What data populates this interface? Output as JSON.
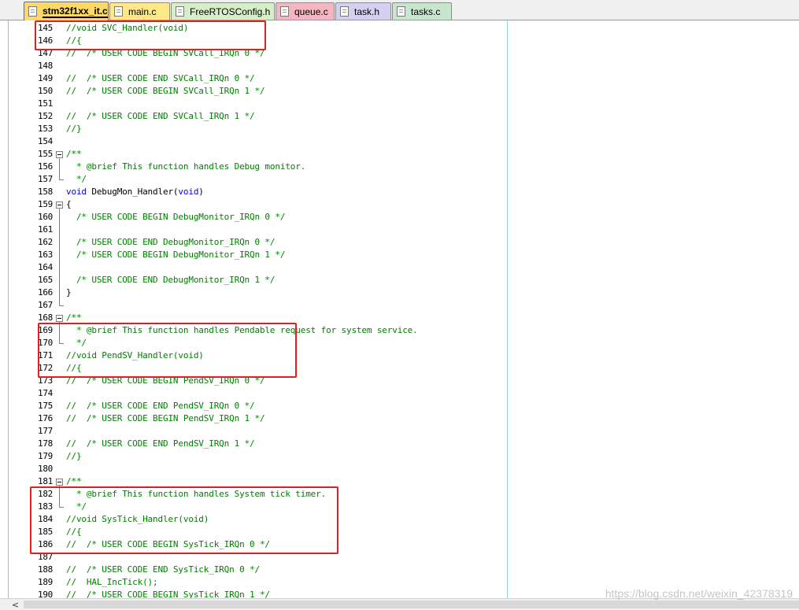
{
  "tabs": [
    {
      "label": "stm32f1xx_it.c",
      "active": true,
      "color": "#ffd966"
    },
    {
      "label": "main.c",
      "active": false,
      "color": "#ffe88a"
    },
    {
      "label": "FreeRTOSConfig.h",
      "active": false,
      "color": "#d7efc9"
    },
    {
      "label": "queue.c",
      "active": false,
      "color": "#f4b6c2"
    },
    {
      "label": "task.h",
      "active": false,
      "color": "#d5d0f2"
    },
    {
      "label": "tasks.c",
      "active": false,
      "color": "#c8e6cd"
    }
  ],
  "lines": [
    {
      "num": "145",
      "fold": "none",
      "parts": [
        {
          "t": "c",
          "s": "//void SVC_Handler(void)"
        }
      ]
    },
    {
      "num": "146",
      "fold": "none",
      "parts": [
        {
          "t": "c",
          "s": "//{"
        }
      ]
    },
    {
      "num": "147",
      "fold": "none",
      "parts": [
        {
          "t": "c",
          "s": "//  /* USER CODE BEGIN SVCall_IRQn 0 */"
        }
      ]
    },
    {
      "num": "148",
      "fold": "none",
      "parts": []
    },
    {
      "num": "149",
      "fold": "none",
      "parts": [
        {
          "t": "c",
          "s": "//  /* USER CODE END SVCall_IRQn 0 */"
        }
      ]
    },
    {
      "num": "150",
      "fold": "none",
      "parts": [
        {
          "t": "c",
          "s": "//  /* USER CODE BEGIN SVCall_IRQn 1 */"
        }
      ]
    },
    {
      "num": "151",
      "fold": "none",
      "parts": []
    },
    {
      "num": "152",
      "fold": "none",
      "parts": [
        {
          "t": "c",
          "s": "//  /* USER CODE END SVCall_IRQn 1 */"
        }
      ]
    },
    {
      "num": "153",
      "fold": "none",
      "parts": [
        {
          "t": "c",
          "s": "//}"
        }
      ]
    },
    {
      "num": "154",
      "fold": "none",
      "parts": []
    },
    {
      "num": "155",
      "fold": "start",
      "parts": [
        {
          "t": "c",
          "s": "/**"
        }
      ]
    },
    {
      "num": "156",
      "fold": "line",
      "parts": [
        {
          "t": "c",
          "s": "  * @brief This function handles Debug monitor."
        }
      ]
    },
    {
      "num": "157",
      "fold": "end",
      "parts": [
        {
          "t": "c",
          "s": "  */"
        }
      ]
    },
    {
      "num": "158",
      "fold": "none",
      "parts": [
        {
          "t": "k",
          "s": "void"
        },
        {
          "t": "x",
          "s": " DebugMon_Handler("
        },
        {
          "t": "k",
          "s": "void"
        },
        {
          "t": "x",
          "s": ")"
        }
      ]
    },
    {
      "num": "159",
      "fold": "start",
      "parts": [
        {
          "t": "x",
          "s": "{"
        }
      ]
    },
    {
      "num": "160",
      "fold": "line",
      "parts": [
        {
          "t": "c",
          "s": "  /* USER CODE BEGIN DebugMonitor_IRQn 0 */"
        }
      ]
    },
    {
      "num": "161",
      "fold": "line",
      "parts": []
    },
    {
      "num": "162",
      "fold": "line",
      "parts": [
        {
          "t": "c",
          "s": "  /* USER CODE END DebugMonitor_IRQn 0 */"
        }
      ]
    },
    {
      "num": "163",
      "fold": "line",
      "parts": [
        {
          "t": "c",
          "s": "  /* USER CODE BEGIN DebugMonitor_IRQn 1 */"
        }
      ]
    },
    {
      "num": "164",
      "fold": "line",
      "parts": []
    },
    {
      "num": "165",
      "fold": "line",
      "parts": [
        {
          "t": "c",
          "s": "  /* USER CODE END DebugMonitor_IRQn 1 */"
        }
      ]
    },
    {
      "num": "166",
      "fold": "line",
      "parts": [
        {
          "t": "x",
          "s": "}"
        }
      ]
    },
    {
      "num": "167",
      "fold": "end",
      "parts": []
    },
    {
      "num": "168",
      "fold": "start",
      "parts": [
        {
          "t": "c",
          "s": "/**"
        }
      ]
    },
    {
      "num": "169",
      "fold": "line",
      "parts": [
        {
          "t": "c",
          "s": "  * @brief This function handles Pendable request for system service."
        }
      ]
    },
    {
      "num": "170",
      "fold": "end",
      "parts": [
        {
          "t": "c",
          "s": "  */"
        }
      ]
    },
    {
      "num": "171",
      "fold": "none",
      "parts": [
        {
          "t": "c",
          "s": "//void PendSV_Handler(void)"
        }
      ]
    },
    {
      "num": "172",
      "fold": "none",
      "parts": [
        {
          "t": "c",
          "s": "//{"
        }
      ]
    },
    {
      "num": "173",
      "fold": "none",
      "parts": [
        {
          "t": "c",
          "s": "//  /* USER CODE BEGIN PendSV_IRQn 0 */"
        }
      ]
    },
    {
      "num": "174",
      "fold": "none",
      "parts": []
    },
    {
      "num": "175",
      "fold": "none",
      "parts": [
        {
          "t": "c",
          "s": "//  /* USER CODE END PendSV_IRQn 0 */"
        }
      ]
    },
    {
      "num": "176",
      "fold": "none",
      "parts": [
        {
          "t": "c",
          "s": "//  /* USER CODE BEGIN PendSV_IRQn 1 */"
        }
      ]
    },
    {
      "num": "177",
      "fold": "none",
      "parts": []
    },
    {
      "num": "178",
      "fold": "none",
      "parts": [
        {
          "t": "c",
          "s": "//  /* USER CODE END PendSV_IRQn 1 */"
        }
      ]
    },
    {
      "num": "179",
      "fold": "none",
      "parts": [
        {
          "t": "c",
          "s": "//}"
        }
      ]
    },
    {
      "num": "180",
      "fold": "none",
      "parts": []
    },
    {
      "num": "181",
      "fold": "start",
      "parts": [
        {
          "t": "c",
          "s": "/**"
        }
      ]
    },
    {
      "num": "182",
      "fold": "line",
      "parts": [
        {
          "t": "c",
          "s": "  * @brief This function handles System tick timer."
        }
      ]
    },
    {
      "num": "183",
      "fold": "end",
      "parts": [
        {
          "t": "c",
          "s": "  */"
        }
      ]
    },
    {
      "num": "184",
      "fold": "none",
      "parts": [
        {
          "t": "c",
          "s": "//void SysTick_Handler(void)"
        }
      ]
    },
    {
      "num": "185",
      "fold": "none",
      "parts": [
        {
          "t": "c",
          "s": "//{"
        }
      ]
    },
    {
      "num": "186",
      "fold": "none",
      "parts": [
        {
          "t": "c",
          "s": "//  /* USER CODE BEGIN SysTick_IRQn 0 */"
        }
      ]
    },
    {
      "num": "187",
      "fold": "none",
      "parts": []
    },
    {
      "num": "188",
      "fold": "none",
      "parts": [
        {
          "t": "c",
          "s": "//  /* USER CODE END SysTick_IRQn 0 */"
        }
      ]
    },
    {
      "num": "189",
      "fold": "none",
      "parts": [
        {
          "t": "c",
          "s": "//  HAL_IncTick();"
        }
      ]
    },
    {
      "num": "190",
      "fold": "none",
      "parts": [
        {
          "t": "c",
          "s": "//  /* USER CODE BEGIN SysTick_IRQn 1 */"
        }
      ]
    }
  ],
  "highlight_color": "#e0201f",
  "highlights": [
    {
      "name": "highlight-svc-handler",
      "from": 0,
      "to": 1
    },
    {
      "name": "highlight-pendsv-handler",
      "from": 24,
      "to": 27
    },
    {
      "name": "highlight-systick-handler",
      "from": 37,
      "to": 41
    }
  ],
  "scrollbar": {
    "left_arrow": "<"
  },
  "watermark": "https://blog.csdn.net/weixin_42378319"
}
